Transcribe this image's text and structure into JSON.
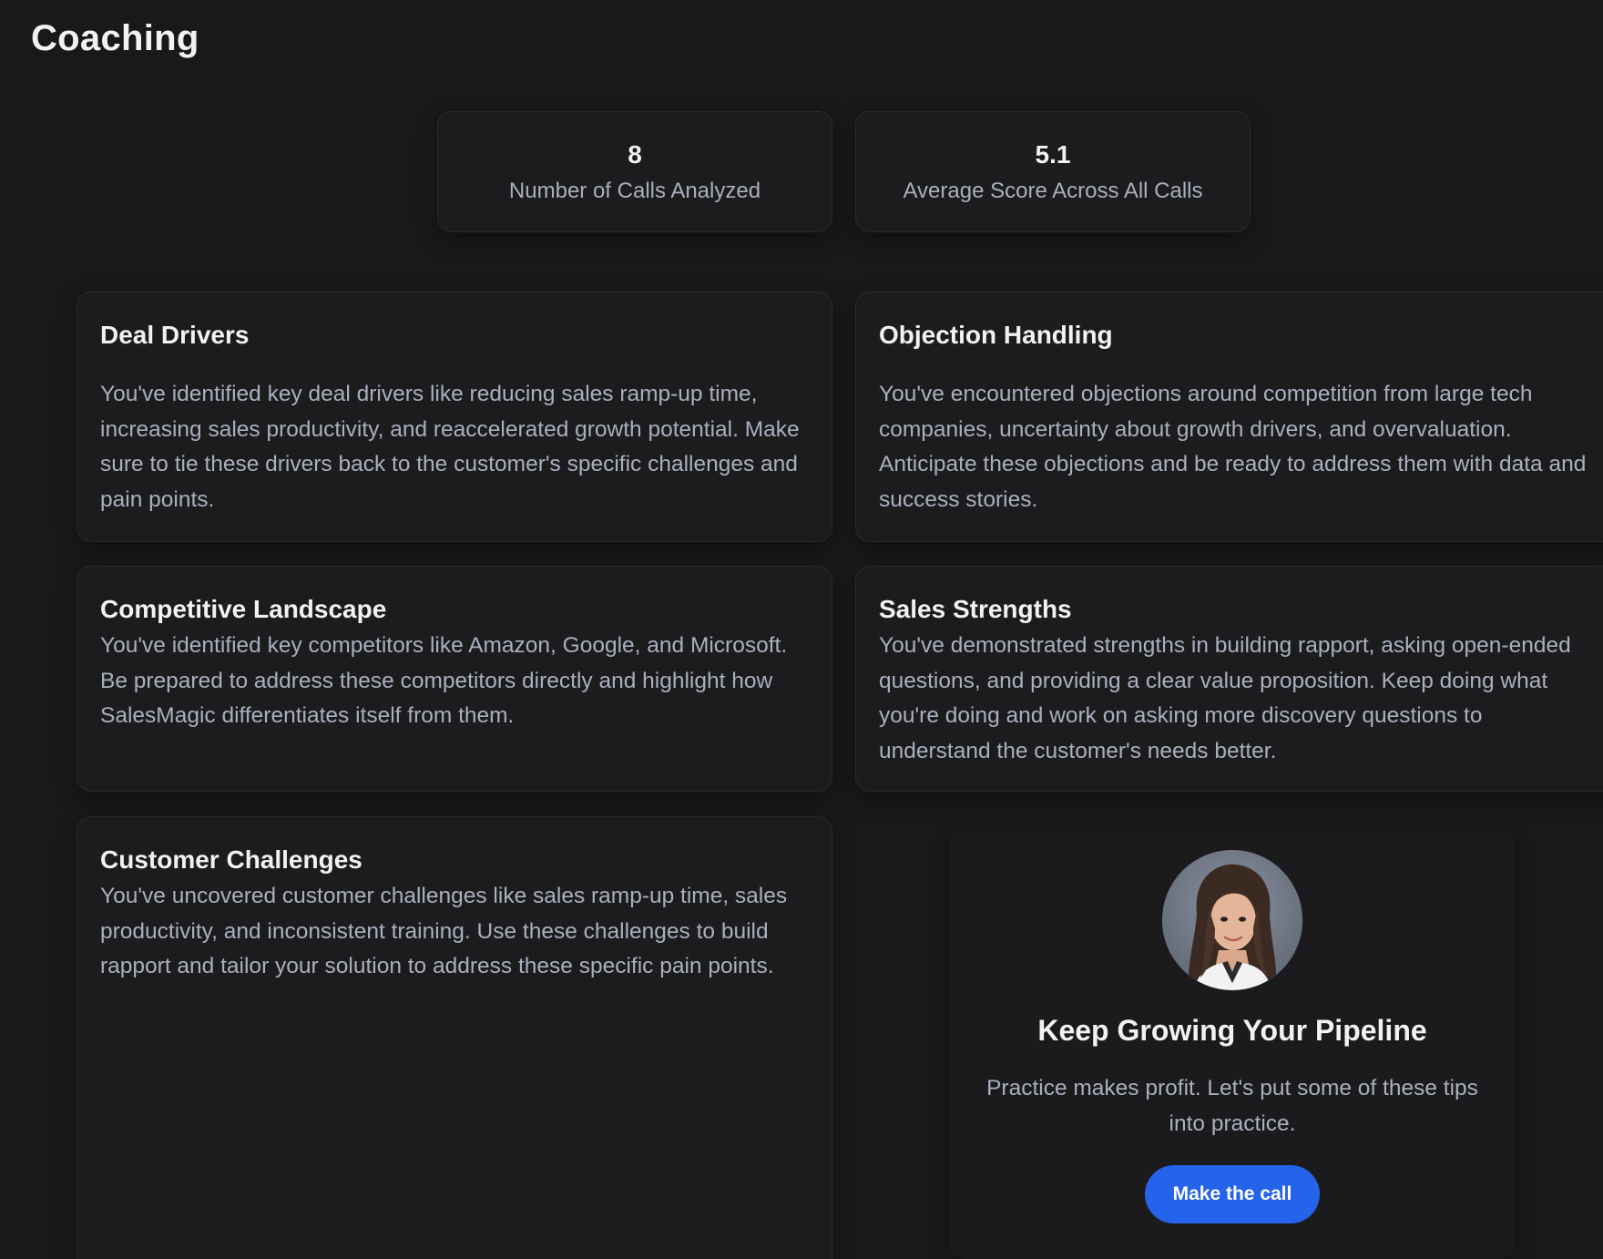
{
  "page": {
    "title": "Coaching"
  },
  "stats": [
    {
      "value": "8",
      "label": "Number of Calls Analyzed"
    },
    {
      "value": "5.1",
      "label": "Average Score Across All Calls"
    }
  ],
  "sections": {
    "deal_drivers": {
      "title": "Deal Drivers",
      "body": "You've identified key deal drivers like reducing sales ramp-up time, increasing sales productivity, and reaccelerated growth potential. Make sure to tie these drivers back to the customer's specific challenges and pain points."
    },
    "objection_handling": {
      "title": "Objection Handling",
      "body": "You've encountered objections around competition from large tech companies, uncertainty about growth drivers, and overvaluation. Anticipate these objections and be ready to address them with data and success stories."
    },
    "competitive_landscape": {
      "title": "Competitive Landscape",
      "body": "You've identified key competitors like Amazon, Google, and Microsoft. Be prepared to address these competitors directly and highlight how SalesMagic differentiates itself from them."
    },
    "sales_strengths": {
      "title": "Sales Strengths",
      "body": "You've demonstrated strengths in building rapport, asking open-ended questions, and providing a clear value proposition. Keep doing what you're doing and work on asking more discovery questions to understand the customer's needs better."
    },
    "customer_challenges": {
      "title": "Customer Challenges",
      "body": "You've uncovered customer challenges like sales ramp-up time, sales productivity, and inconsistent training. Use these challenges to build rapport and tailor your solution to address these specific pain points."
    }
  },
  "cta": {
    "title": "Keep Growing Your Pipeline",
    "text": "Practice makes profit. Let's put some of these tips into practice.",
    "button_label": "Make the call"
  },
  "colors": {
    "background": "#19191b",
    "card": "#1c1c1f",
    "heading": "#f2f2f4",
    "body_text": "#a9b0bd",
    "accent": "#2563eb"
  }
}
